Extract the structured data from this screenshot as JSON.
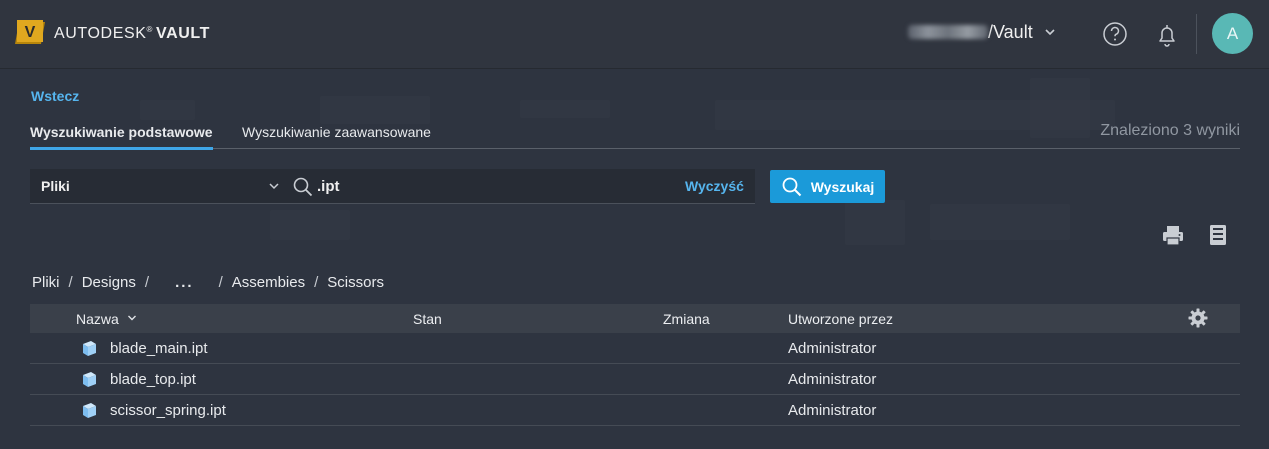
{
  "header": {
    "brand_regular": "AUTODESK",
    "brand_mark": "®",
    "brand_bold": "VAULT",
    "logo_letter": "V",
    "vault_name": "/Vault",
    "avatar_initial": "A"
  },
  "back_link": "Wstecz",
  "tabs": [
    {
      "label": "Wyszukiwanie podstawowe",
      "active": true
    },
    {
      "label": "Wyszukiwanie zaawansowane",
      "active": false
    }
  ],
  "results_count_text": "Znaleziono 3 wyniki",
  "search": {
    "scope": "Pliki",
    "query": ".ipt",
    "clear_label": "Wyczyść",
    "button_label": "Wyszukaj"
  },
  "breadcrumb": {
    "items": [
      "Pliki",
      "Designs",
      "...",
      "Assembies",
      "Scissors"
    ],
    "separator": "/"
  },
  "table": {
    "columns": [
      "Nazwa",
      "Stan",
      "Zmiana",
      "Utworzone przez"
    ],
    "rows": [
      {
        "name": "blade_main.ipt",
        "state": "",
        "change": "",
        "created_by": "Administrator"
      },
      {
        "name": "blade_top.ipt",
        "state": "",
        "change": "",
        "created_by": "Administrator"
      },
      {
        "name": "scissor_spring.ipt",
        "state": "",
        "change": "",
        "created_by": "Administrator"
      }
    ]
  },
  "icons": {
    "logo": "autodesk-vault-logo-icon",
    "help": "help-icon",
    "notifications": "bell-icon",
    "search": "search-icon",
    "print": "printer-icon",
    "export": "export-icon",
    "settings": "gear-icon",
    "file": "part-file-icon"
  },
  "colors": {
    "accent": "#1b9ad9",
    "link": "#56b5ee",
    "logo_gold": "#e0a81f",
    "avatar": "#59b8b5",
    "background": "#2e3440"
  }
}
